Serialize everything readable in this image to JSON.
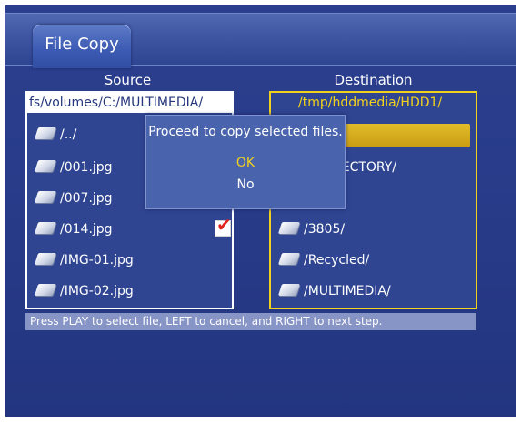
{
  "window": {
    "title": "File Copy"
  },
  "source": {
    "header": "Source",
    "path": "fs/volumes/C:/MULTIMEDIA/",
    "items": [
      {
        "label": "/../",
        "icon": "folder-icon"
      },
      {
        "label": "/001.jpg",
        "icon": "file-icon"
      },
      {
        "label": "/007.jpg",
        "icon": "file-icon"
      },
      {
        "label": "/014.jpg",
        "icon": "file-icon",
        "checked": true
      },
      {
        "label": "/IMG-01.jpg",
        "icon": "file-icon"
      },
      {
        "label": "/IMG-02.jpg",
        "icon": "file-icon"
      }
    ]
  },
  "destination": {
    "header": "Destination",
    "path": "/tmp/hddmedia/HDD1/",
    "items": [
      {
        "label": "",
        "selected": true
      },
      {
        "label": "RECTORY/"
      },
      {
        "label": ""
      },
      {
        "label": "/3805/",
        "icon": "folder-icon"
      },
      {
        "label": "/Recycled/",
        "icon": "folder-icon"
      },
      {
        "label": "/MULTIMEDIA/",
        "icon": "folder-icon"
      }
    ]
  },
  "hint": "Press PLAY to select file, LEFT to cancel, and RIGHT to next step.",
  "dialog": {
    "message": "Proceed to copy selected files.",
    "ok_label": "OK",
    "no_label": "No"
  },
  "colors": {
    "background": "#283c8b",
    "accent_yellow": "#f2d21c",
    "checkmark_red": "#e0261c"
  }
}
